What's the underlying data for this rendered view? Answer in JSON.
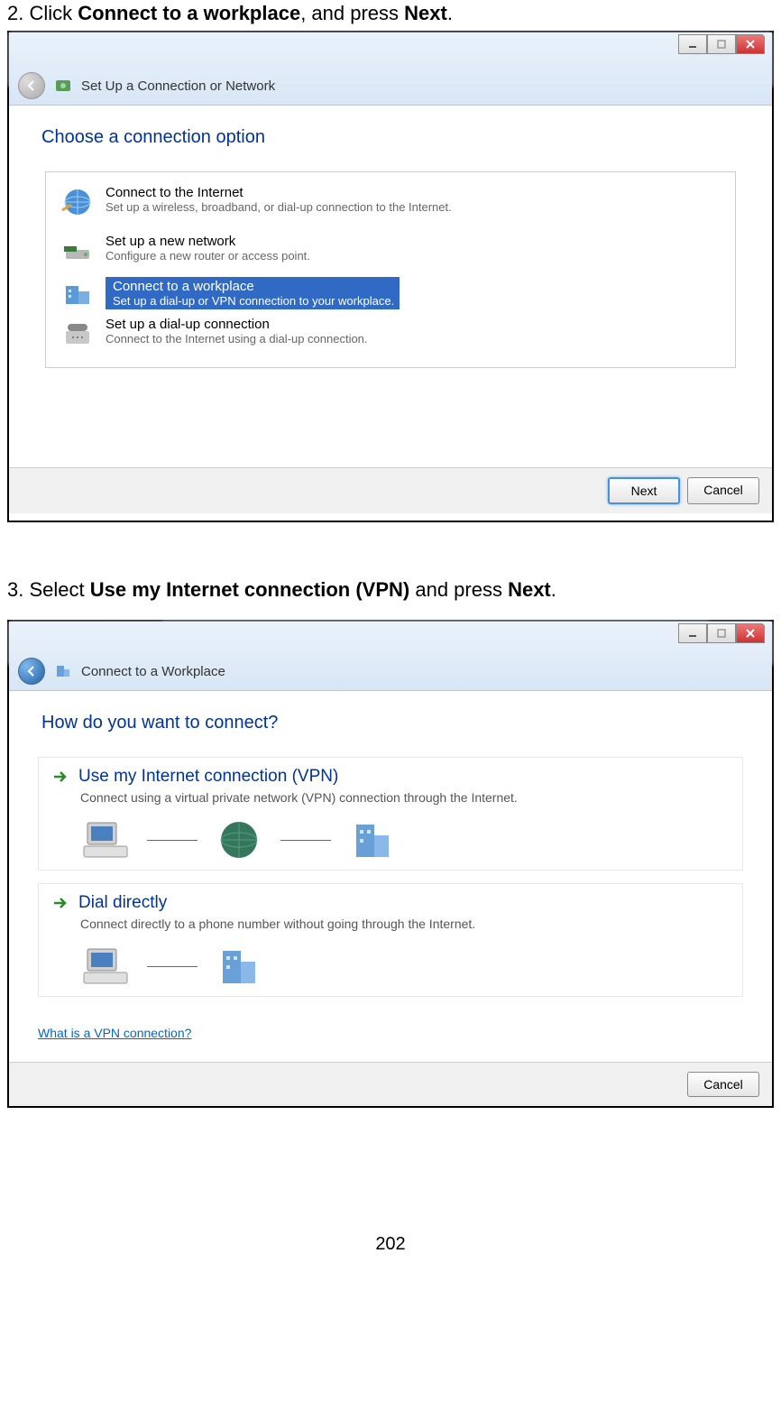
{
  "step2": {
    "prefix": "2. Click ",
    "bold1": "Connect to a workplace",
    "mid": ", and press ",
    "bold2": "Next",
    "suffix": ".",
    "window_title": "Set Up a Connection or Network",
    "heading": "Choose a connection option",
    "options": [
      {
        "title": "Connect to the Internet",
        "sub": "Set up a wireless, broadband, or dial-up connection to the Internet."
      },
      {
        "title": "Set up a new network",
        "sub": "Configure a new router or access point."
      },
      {
        "title": "Connect to a workplace",
        "sub": "Set up a dial-up or VPN connection to your workplace."
      },
      {
        "title": "Set up a dial-up connection",
        "sub": "Connect to the Internet using a dial-up connection."
      }
    ],
    "next_label": "Next",
    "cancel_label": "Cancel"
  },
  "step3": {
    "prefix": "3. Select ",
    "bold1": "Use my Internet connection (VPN)",
    "mid": " and press ",
    "bold2": "Next",
    "suffix": ".",
    "window_title": "Connect to a Workplace",
    "heading": "How do you want to connect?",
    "choices": [
      {
        "title": "Use my Internet connection (VPN)",
        "sub": "Connect using a virtual private network (VPN) connection through the Internet."
      },
      {
        "title": "Dial directly",
        "sub": "Connect directly to a phone number without going through the Internet."
      }
    ],
    "help_link": "What is a VPN connection?",
    "cancel_label": "Cancel"
  },
  "page_number": "202"
}
